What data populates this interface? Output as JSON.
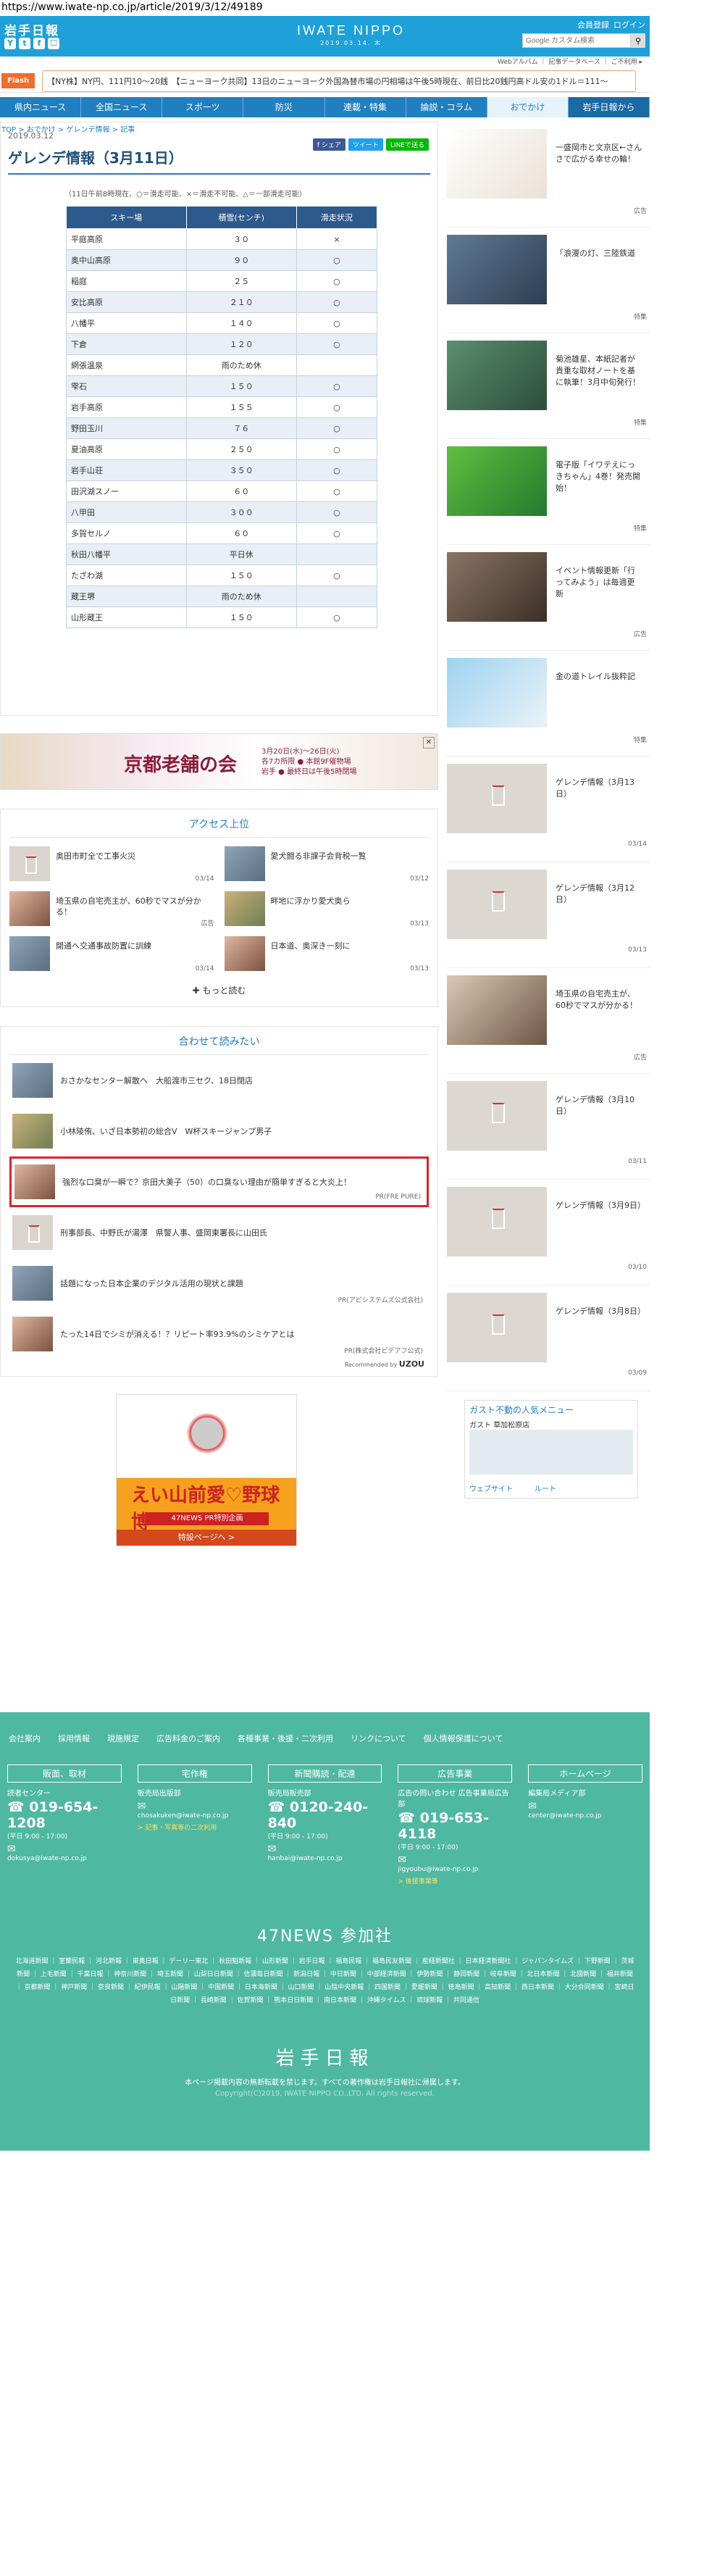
{
  "browser": {
    "url": "https://www.iwate-np.co.jp/article/2019/3/12/49189"
  },
  "header": {
    "logo": "岩手日報",
    "brand": "IWATE NIPPO",
    "brand_date": "2019.03.14. 木",
    "member": "会員登録",
    "login": "ログイン",
    "search_placeholder": "Google カスタム検索",
    "sublinks": "Webアルバム ｜ 記事データベース ｜ ご不利用 ▸",
    "social": [
      "Y",
      "t",
      "f",
      "☐"
    ]
  },
  "flash": {
    "tag": "Flash",
    "text": "【NY株】NY円、111円10〜20銭　【ニューヨーク共同】13日のニューヨーク外国為替市場の円相場は午後5時現在、前日比20銭円高ドル安の1ドル＝111〜"
  },
  "nav": {
    "items": [
      "県内ニュース",
      "全国ニュース",
      "スポーツ",
      "防災",
      "連載・特集",
      "論説・コラム",
      "おでかけ",
      "岩手日報から"
    ]
  },
  "breadcrumb": "TOP > おでかけ > ゲレンデ情報 > 記事",
  "article": {
    "date": "2019.03.12",
    "title": "ゲレンデ情報（3月11日）",
    "legend": "（11日午前8時現在、○＝滑走可能、×＝滑走不可能、△＝一部滑走可能）",
    "shares": [
      "f シェア",
      "ツイート",
      "LINEで送る"
    ],
    "table_headers": [
      "スキー場",
      "積雪(センチ)",
      "滑走状況"
    ],
    "rows": [
      [
        "平庭高原",
        "３０",
        "×"
      ],
      [
        "奥中山高原",
        "９０",
        "○"
      ],
      [
        "稲庭",
        "２５",
        "○"
      ],
      [
        "安比高原",
        "２１０",
        "○"
      ],
      [
        "八幡平",
        "１４０",
        "○"
      ],
      [
        "下倉",
        "１２０",
        "○"
      ],
      [
        "網張温泉",
        "雨のため休",
        ""
      ],
      [
        "雫石",
        "１５０",
        "○"
      ],
      [
        "岩手高原",
        "１５５",
        "○"
      ],
      [
        "野田玉川",
        "７６",
        "○"
      ],
      [
        "夏油高原",
        "２５０",
        "○"
      ],
      [
        "岩手山荘",
        "３５０",
        "○"
      ],
      [
        "田沢湖スノー",
        "６０",
        "○"
      ],
      [
        "八甲田",
        "３００",
        "○"
      ],
      [
        "多賀セルノ",
        "６０",
        "○"
      ],
      [
        "秋田八幡平",
        "平日休",
        ""
      ],
      [
        "たざわ湖",
        "１５０",
        "○"
      ],
      [
        "蔵王堺",
        "雨のため休",
        ""
      ],
      [
        "山形蔵王",
        "１５０",
        "○"
      ]
    ]
  },
  "ad_banner": {
    "title": "京都老舗の会",
    "sub": "3月20日(水)〜26日(火)\n各7カ所限 ● 本館9F催物場\n岩手 ● 最終日は午後5時閉場"
  },
  "ranking": {
    "title": "アクセス上位",
    "items": [
      {
        "title": "奥田市町全で工事火災",
        "date": "03/14"
      },
      {
        "title": "愛犬闘る非課子会背税一覧",
        "date": "03/12"
      },
      {
        "title": "埼玉県の自宅売主が、60秒でマスが分かる！",
        "date": "広告"
      },
      {
        "title": "畔地に浮かり愛犬奥ら",
        "date": "03/13"
      },
      {
        "title": "開通へ交通事故防置に訓練",
        "date": "03/14"
      },
      {
        "title": "日本道、奥深き一刻に",
        "date": "03/13"
      }
    ],
    "more": "もっと読む"
  },
  "related": {
    "title": "合わせて読みたい",
    "items": [
      {
        "title": "おさかなセンター解散へ　大船渡市三セク、18日閉店",
        "pr": ""
      },
      {
        "title": "小林陵侑、いざ日本勢初の総合V　W杯スキージャンプ男子",
        "pr": ""
      },
      {
        "title": "強烈な口臭が一瞬で？京田大美子（50）の口臭ない理由が簡単すぎると大炎上！",
        "pr": "PR(FRE PURE)"
      },
      {
        "title": "刑事部長、中野氏が湯澤　県警人事、盛岡東署長に山田氏",
        "pr": ""
      },
      {
        "title": "話題になった日本企業のデジタル活用の現状と課題",
        "pr": "PR(アビシステムズ公式会社)"
      },
      {
        "title": "たった14日でシミが消える！？リピート率93.9%のシミケアとは",
        "pr": "PR(株式会社ビデアフ公式)"
      }
    ],
    "recommended": "Recommended by",
    "recommended_brand": "UZOU"
  },
  "baseball": {
    "title": "えい山前愛♡野球博",
    "bar": "47NEWS PR特別企画",
    "link": "特設ページへ >"
  },
  "sidebar": {
    "items": [
      {
        "title": "一盛岡市と文京区←さんさで広がる幸せの輪！",
        "date": "広告"
      },
      {
        "title": "「浪漫の灯、三陸鉄道",
        "date": "特集"
      },
      {
        "title": "菊池雄星、本紙記者が貴重な取材ノートを基に執筆！3月中旬発行！",
        "date": "特集"
      },
      {
        "title": "電子版「イワテえにっきちゃん」4巻！発売開始！",
        "date": "特集"
      },
      {
        "title": "イベント情報更新「行ってみよう」は毎週更新",
        "date": "広告"
      },
      {
        "title": "金の道トレイル抜粋記",
        "date": "特集"
      },
      {
        "title": "ゲレンデ情報（3月13日）",
        "date": "03/14"
      },
      {
        "title": "ゲレンデ情報（3月12日）",
        "date": "03/13"
      },
      {
        "title": "埼玉県の自宅売主が、60秒でマスが分かる！",
        "date": "広告"
      },
      {
        "title": "ゲレンデ情報（3月10日）",
        "date": "03/11"
      },
      {
        "title": "ゲレンデ情報（3月9日）",
        "date": "03/10"
      },
      {
        "title": "ゲレンデ情報（3月8日）",
        "date": "03/09"
      }
    ],
    "gadget": {
      "title": "ガスト不動の人気メニュー",
      "sub": "ガスト 草加松原店",
      "web": "ウェブサイト",
      "route": "ルート"
    }
  },
  "footer": {
    "links": [
      "会社案内",
      "採用情報",
      "現施規定",
      "広告料金のご案内",
      "各種事業・後援・二次利用",
      "リンクについて",
      "個人情報保護について"
    ],
    "cols": [
      {
        "h": "販面、取材",
        "sub": "読者センター",
        "tel": "019-654-1208",
        "sm": "(平日 9:00 - 17:00)",
        "mail": "dokusya@iwate-np.co.jp",
        "gold": ""
      },
      {
        "h": "宅作権",
        "sub": "販売局出版部",
        "tel": "",
        "sm": "",
        "mail": "chosakuken@iwate-np.co.jp",
        "gold": "> 記事・写真等の二次利用"
      },
      {
        "h": "新聞購読・配達",
        "sub": "販売局販売部",
        "tel": "0120-240-840",
        "sm": "(平日 9:00 - 17:00)",
        "mail": "hanbai@iwate-np.co.jp",
        "gold": ""
      },
      {
        "h": "広告事業",
        "sub": "広告の問い合わせ 広告事業局広告部",
        "tel": "019-653-4118",
        "sm": "(平日 9:00 - 17:00)",
        "mail": "jigyoubu@iwate-np.co.jp",
        "gold": "> 後援事業等"
      },
      {
        "h": "ホームページ",
        "sub": "編集局メディア部",
        "tel": "",
        "sm": "",
        "mail": "center@iwate-np.co.jp",
        "gold": ""
      }
    ],
    "news47": "47NEWS 参加社",
    "papers": "北海道新聞 ｜ 室蘭民報 ｜ 河北新報 ｜ 東奥日報 ｜ デーリー東北 ｜ 秋田魁新報 ｜ 山形新聞 ｜ 岩手日報 ｜ 福島民報 ｜ 福島民友新聞 ｜ 産経新聞社 ｜ 日本経済新聞社 ｜ ジャパンタイムズ ｜ 下野新聞 ｜ 茨城新聞 ｜ 上毛新聞 ｜ 千葉日報 ｜ 神奈川新聞 ｜ 埼玉新聞 ｜ 山梨日日新聞 ｜ 信濃毎日新聞 ｜ 新潟日報 ｜ 中日新聞 ｜ 中部経済新聞 ｜ 伊勢新聞 ｜ 静岡新聞 ｜ 岐阜新聞 ｜ 北日本新聞 ｜ 北國新聞 ｜ 福井新聞 ｜ 京都新聞 ｜ 神戸新聞 ｜ 奈良新聞 ｜ 紀伊民報 ｜ 山陽新聞 ｜ 中国新聞 ｜ 日本海新聞 ｜ 山口新聞 ｜ 山陰中央新報 ｜ 四国新聞 ｜ 愛媛新聞 ｜ 徳島新聞 ｜ 高知新聞 ｜ 西日本新聞 ｜ 大分合同新聞 ｜ 宮崎日日新聞 ｜ 長崎新聞 ｜ 佐賀新聞 ｜ 熊本日日新聞 ｜ 南日本新聞 ｜ 沖縄タイムス ｜ 琉球新報 ｜ 共同通信",
    "logo": "岩手日報",
    "copy": "本ページ掲載内容の無断転載を禁じます。すべての著作権は岩手日報社に帰属します。",
    "copy2": "Copyright(C)2019, IWATE NIPPO CO.,LTD. All rights reserved."
  }
}
